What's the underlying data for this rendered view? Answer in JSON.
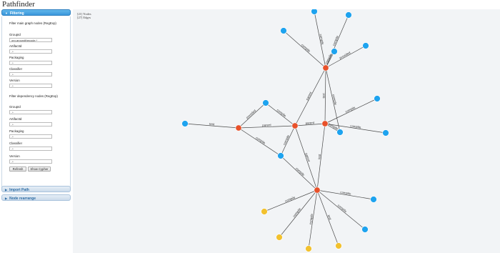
{
  "app": {
    "title": "Pathfinder"
  },
  "colors": {
    "accent": "#3a98dc",
    "node_main": "#e8512a",
    "node_dependency": "#1ea3ef",
    "node_import": "#f2c12e"
  },
  "sidebar": {
    "filtering": {
      "header": "Filtering",
      "main_heading": "Filter main graph nodes (RegExp)",
      "main_fields": [
        {
          "label": "GroupId",
          "value": "org.aroundthecode.*"
        },
        {
          "label": "ArtifactId",
          "value": ".*"
        },
        {
          "label": "Packaging",
          "value": ".*"
        },
        {
          "label": "Classifier",
          "value": ".*"
        },
        {
          "label": "Version",
          "value": ".*"
        }
      ],
      "dep_heading": "Filter dependency nodes (RegExp)",
      "dep_fields": [
        {
          "label": "GroupId",
          "value": ".*"
        },
        {
          "label": "ArtifactId",
          "value": ".*"
        },
        {
          "label": "Packaging",
          "value": ".*"
        },
        {
          "label": "Classifier",
          "value": ".*"
        },
        {
          "label": "Version",
          "value": ".*"
        }
      ],
      "refresh_label": "Refresh",
      "cypher_label": "Show Cypher"
    },
    "import_path": {
      "header": "Import Path"
    },
    "node_rearrange": {
      "header": "Node rearrange"
    }
  },
  "graph": {
    "stats": {
      "nodes": "[21] Nodes",
      "edges": "[27] Edges"
    },
    "nodes": [
      {
        "id": "A",
        "kind": "main"
      },
      {
        "id": "B",
        "kind": "main"
      },
      {
        "id": "C",
        "kind": "main"
      },
      {
        "id": "D",
        "kind": "main"
      },
      {
        "id": "E",
        "kind": "main"
      },
      {
        "id": "t1",
        "kind": "dependency"
      },
      {
        "id": "t2",
        "kind": "dependency"
      },
      {
        "id": "t3",
        "kind": "dependency"
      },
      {
        "id": "t4",
        "kind": "dependency"
      },
      {
        "id": "t5",
        "kind": "dependency"
      },
      {
        "id": "m1",
        "kind": "dependency"
      },
      {
        "id": "m2",
        "kind": "dependency"
      },
      {
        "id": "m3",
        "kind": "dependency"
      },
      {
        "id": "m4",
        "kind": "dependency"
      },
      {
        "id": "m5",
        "kind": "dependency"
      },
      {
        "id": "m6",
        "kind": "dependency"
      },
      {
        "id": "b1",
        "kind": "dependency"
      },
      {
        "id": "b2",
        "kind": "dependency"
      },
      {
        "id": "y1",
        "kind": "import"
      },
      {
        "id": "y2",
        "kind": "import"
      },
      {
        "id": "y3",
        "kind": "import"
      },
      {
        "id": "y4",
        "kind": "import"
      }
    ],
    "edges": [
      {
        "from": "A",
        "to": "t1",
        "label": "compile"
      },
      {
        "from": "A",
        "to": "t2",
        "label": "compile"
      },
      {
        "from": "A",
        "to": "t3",
        "label": "compile"
      },
      {
        "from": "A",
        "to": "t4",
        "label": "provided"
      },
      {
        "from": "A",
        "to": "t5",
        "label": "compile"
      },
      {
        "from": "A",
        "to": "B",
        "label": "parent"
      },
      {
        "from": "A",
        "to": "C",
        "label": "test"
      },
      {
        "from": "D",
        "to": "m1",
        "label": "test"
      },
      {
        "from": "D",
        "to": "B",
        "label": "parent"
      },
      {
        "from": "D",
        "to": "m2",
        "label": "compile"
      },
      {
        "from": "D",
        "to": "m4",
        "label": "provided"
      },
      {
        "from": "B",
        "to": "C",
        "label": "parent"
      },
      {
        "from": "B",
        "to": "m2",
        "label": "compile"
      },
      {
        "from": "B",
        "to": "m4",
        "label": "compile"
      },
      {
        "from": "C",
        "to": "m5",
        "label": "compile"
      },
      {
        "from": "C",
        "to": "m6",
        "label": "compile"
      },
      {
        "from": "C",
        "to": "m3",
        "label": "compile"
      },
      {
        "from": "B",
        "to": "E",
        "label": "parent"
      },
      {
        "from": "C",
        "to": "E",
        "label": "test"
      },
      {
        "from": "m2",
        "to": "E",
        "label": "compile"
      },
      {
        "from": "E",
        "to": "b1",
        "label": "compile"
      },
      {
        "from": "E",
        "to": "b2",
        "label": "compile"
      },
      {
        "from": "E",
        "to": "y1",
        "label": "compile"
      },
      {
        "from": "E",
        "to": "y2",
        "label": "compile"
      },
      {
        "from": "E",
        "to": "y3",
        "label": "compile"
      },
      {
        "from": "E",
        "to": "y4",
        "label": "test"
      },
      {
        "from": "A",
        "to": "m3",
        "label": "compile"
      }
    ]
  }
}
